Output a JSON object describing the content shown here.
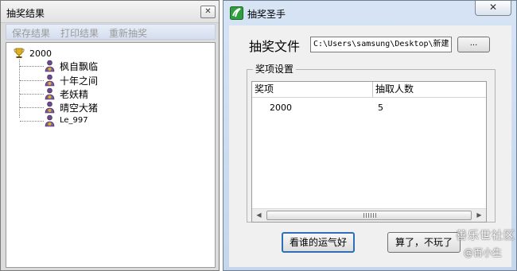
{
  "results_window": {
    "title": "抽奖结果",
    "close_glyph": "✕",
    "toolbar": [
      "保存结果",
      "打印结果",
      "重新抽奖"
    ],
    "tree": {
      "root": "2000",
      "children": [
        "枫自飘临",
        "十年之间",
        "老妖精",
        "晴空大猪",
        "Le_997"
      ]
    }
  },
  "main_window": {
    "title": "抽奖圣手",
    "close_glyph": "✕",
    "file_label": "抽奖文件",
    "file_path": "C:\\Users\\samsung\\Desktop\\新建",
    "browse_label": "...",
    "group_title": "奖项设置",
    "list": {
      "columns": [
        "奖项",
        "抽取人数"
      ],
      "rows": [
        [
          "2000",
          "5"
        ]
      ]
    },
    "scroll_left": "◀",
    "scroll_right": "▶",
    "buttons": {
      "lucky": "看谁的运气好",
      "quit": "算了，不玩了"
    }
  },
  "watermark": {
    "site": "善乐世社区",
    "author": "@百小生"
  },
  "icons": {
    "root": "trophy-icon",
    "child": "winner-icon",
    "app": "app-logo-icon"
  },
  "colors": {
    "focus_border": "#2f6fb5",
    "app_icon_green": "#2e9e3e"
  }
}
